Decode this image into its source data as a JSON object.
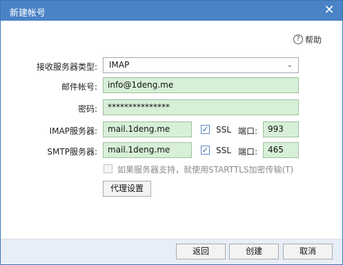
{
  "window": {
    "title": "新建帐号",
    "close_icon": "close-icon"
  },
  "help": {
    "label": "帮助",
    "icon": "help-icon"
  },
  "form": {
    "protocol_label": "接收服务器类型:",
    "protocol_value": "IMAP",
    "account_label": "邮件帐号:",
    "account_value": "info@1deng.me",
    "password_label": "密码:",
    "password_value": "***************",
    "imap_label": "IMAP服务器:",
    "imap_server": "mail.1deng.me",
    "imap_ssl_checked": true,
    "imap_ssl_label": "SSL",
    "imap_port_label": "端口:",
    "imap_port": "993",
    "smtp_label": "SMTP服务器:",
    "smtp_server": "mail.1deng.me",
    "smtp_ssl_checked": true,
    "smtp_ssl_label": "SSL",
    "smtp_port_label": "端口:",
    "smtp_port": "465",
    "starttls_checked": false,
    "starttls_label": "如果服务器支持，就使用STARTTLS加密传输(T)",
    "proxy_button": "代理设置"
  },
  "footer": {
    "back_button": "返回",
    "create_button": "创建",
    "cancel_button": "取消"
  },
  "colors": {
    "titlebar": "#4a83c6",
    "field_bg": "#d7efd7",
    "footer_bg": "#e8eef7"
  }
}
